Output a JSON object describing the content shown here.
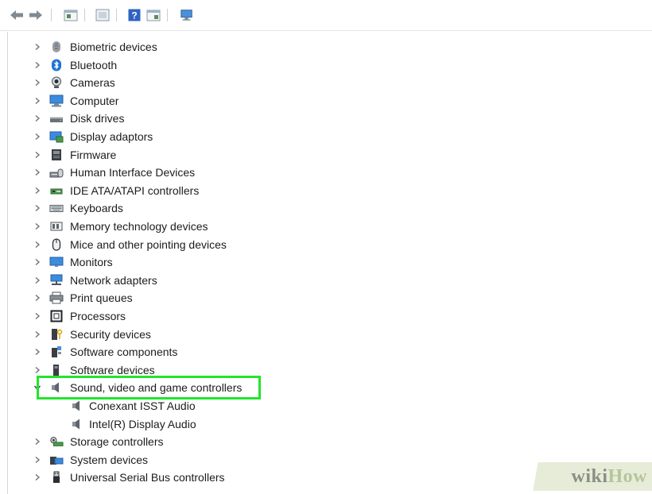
{
  "toolbar": {
    "buttons": [
      {
        "name": "back-arrow-icon"
      },
      {
        "name": "forward-arrow-icon"
      },
      {
        "name": "properties-window-icon"
      },
      {
        "name": "show-hidden-icon"
      },
      {
        "name": "help-icon"
      },
      {
        "name": "action-window-icon"
      },
      {
        "name": "scan-hardware-icon"
      }
    ]
  },
  "tree": {
    "items": [
      {
        "label": "Biometric devices",
        "icon": "fingerprint-icon",
        "expanded": false
      },
      {
        "label": "Bluetooth",
        "icon": "bluetooth-icon",
        "expanded": false
      },
      {
        "label": "Cameras",
        "icon": "camera-icon",
        "expanded": false
      },
      {
        "label": "Computer",
        "icon": "computer-icon",
        "expanded": false
      },
      {
        "label": "Disk drives",
        "icon": "disk-drive-icon",
        "expanded": false
      },
      {
        "label": "Display adaptors",
        "icon": "display-adapter-icon",
        "expanded": false
      },
      {
        "label": "Firmware",
        "icon": "firmware-icon",
        "expanded": false
      },
      {
        "label": "Human Interface Devices",
        "icon": "hid-icon",
        "expanded": false
      },
      {
        "label": "IDE ATA/ATAPI controllers",
        "icon": "ide-controller-icon",
        "expanded": false
      },
      {
        "label": "Keyboards",
        "icon": "keyboard-icon",
        "expanded": false
      },
      {
        "label": "Memory technology devices",
        "icon": "memory-icon",
        "expanded": false
      },
      {
        "label": "Mice and other pointing devices",
        "icon": "mouse-icon",
        "expanded": false
      },
      {
        "label": "Monitors",
        "icon": "monitor-icon",
        "expanded": false
      },
      {
        "label": "Network adapters",
        "icon": "network-adapter-icon",
        "expanded": false
      },
      {
        "label": "Print queues",
        "icon": "printer-icon",
        "expanded": false
      },
      {
        "label": "Processors",
        "icon": "processor-icon",
        "expanded": false
      },
      {
        "label": "Security devices",
        "icon": "security-device-icon",
        "expanded": false
      },
      {
        "label": "Software components",
        "icon": "software-component-icon",
        "expanded": false
      },
      {
        "label": "Software devices",
        "icon": "software-device-icon",
        "expanded": false
      },
      {
        "label": "Sound, video and game controllers",
        "icon": "speaker-icon",
        "expanded": true,
        "children": [
          {
            "label": "Conexant ISST Audio",
            "icon": "speaker-icon"
          },
          {
            "label": "Intel(R) Display Audio",
            "icon": "speaker-icon"
          }
        ]
      },
      {
        "label": "Storage controllers",
        "icon": "storage-controller-icon",
        "expanded": false
      },
      {
        "label": "System devices",
        "icon": "system-device-icon",
        "expanded": false
      },
      {
        "label": "Universal Serial Bus controllers",
        "icon": "usb-icon",
        "expanded": false
      }
    ]
  },
  "watermark": {
    "part1": "wiki",
    "part2": "How"
  },
  "colors": {
    "highlight": "#22e52a",
    "accent_blue": "#2e7fd6"
  }
}
